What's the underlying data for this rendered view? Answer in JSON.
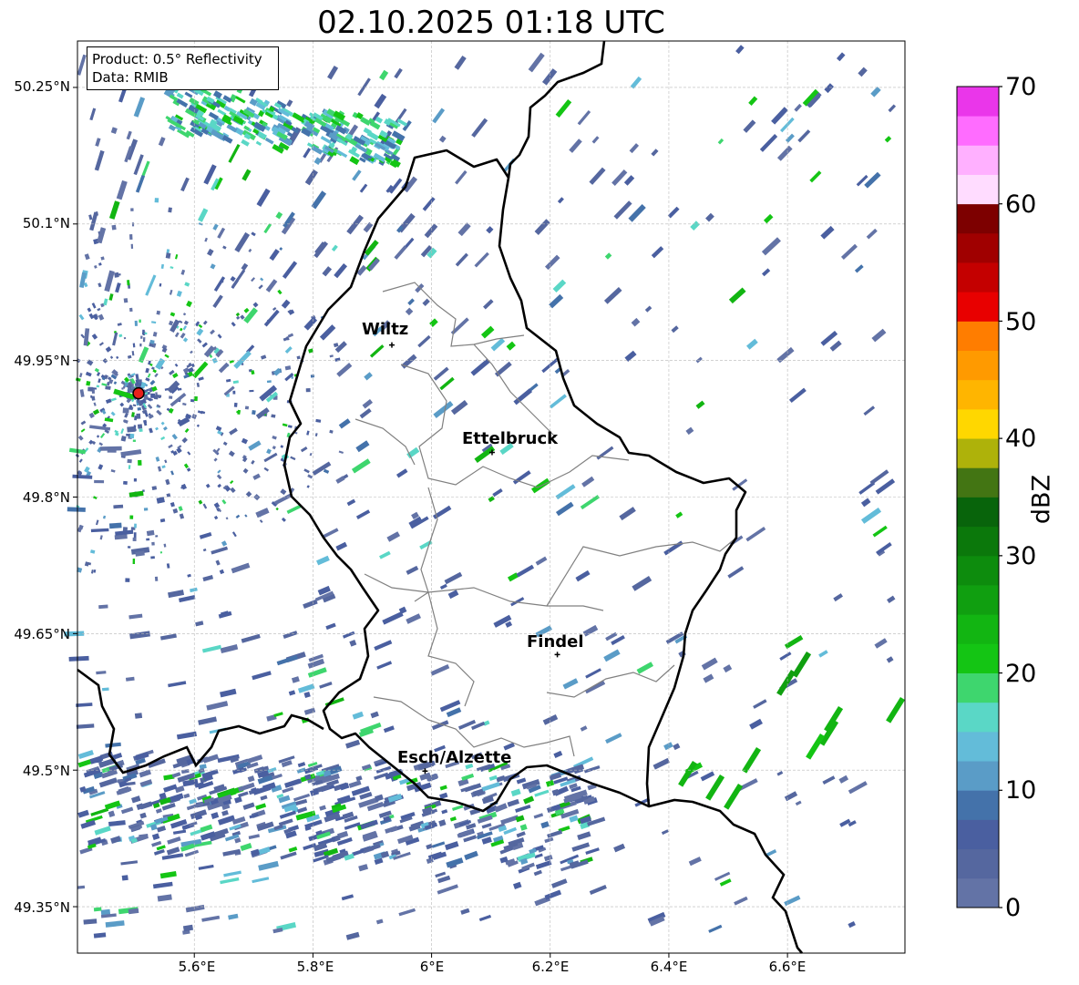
{
  "title": "02.10.2025 01:18 UTC",
  "info": {
    "product": "Product: 0.5° Reflectivity",
    "data": "Data: RMIB"
  },
  "map": {
    "lat_labels": [
      "50.25°N",
      "50.1°N",
      "49.95°N",
      "49.8°N",
      "49.65°N",
      "49.5°N",
      "49.35°N"
    ],
    "lon_labels": [
      "5.6°E",
      "5.8°E",
      "6°E",
      "6.2°E",
      "6.4°E",
      "6.6°E"
    ],
    "extent": {
      "lon_min": 5.403,
      "lon_max": 6.798,
      "lat_min": 49.299,
      "lat_max": 50.301
    },
    "cities": [
      {
        "name": "Wiltz",
        "lon": 5.933,
        "lat": 49.967
      },
      {
        "name": "Ettelbruck",
        "lon": 6.102,
        "lat": 49.849
      },
      {
        "name": "Findel",
        "lon": 6.212,
        "lat": 49.627
      },
      {
        "name": "Esch/Alzette",
        "lon": 5.989,
        "lat": 49.499
      }
    ],
    "radar_site": {
      "lon": 5.506,
      "lat": 49.914,
      "color": "#e8201c"
    },
    "border_color": "#000000",
    "canton_color": "#808080"
  },
  "colorbar": {
    "label": "dBZ",
    "ticks": [
      "70",
      "60",
      "50",
      "40",
      "30",
      "20",
      "10",
      "0"
    ],
    "min": 0,
    "max": 70,
    "colors": [
      "#6373a6",
      "#55679f",
      "#4a5fa0",
      "#4472aa",
      "#5a9cc7",
      "#63bcd9",
      "#5ad7c6",
      "#3ed66e",
      "#14c514",
      "#12b512",
      "#109f10",
      "#0d8c0d",
      "#0b780b",
      "#08640b",
      "#437513",
      "#aeb20a",
      "#ffd700",
      "#ffb500",
      "#ff9a00",
      "#ff7d00",
      "#e80000",
      "#c40000",
      "#a00000",
      "#7d0000",
      "#ffdcff",
      "#ffb0ff",
      "#ff6cff",
      "#ea36ea"
    ]
  }
}
